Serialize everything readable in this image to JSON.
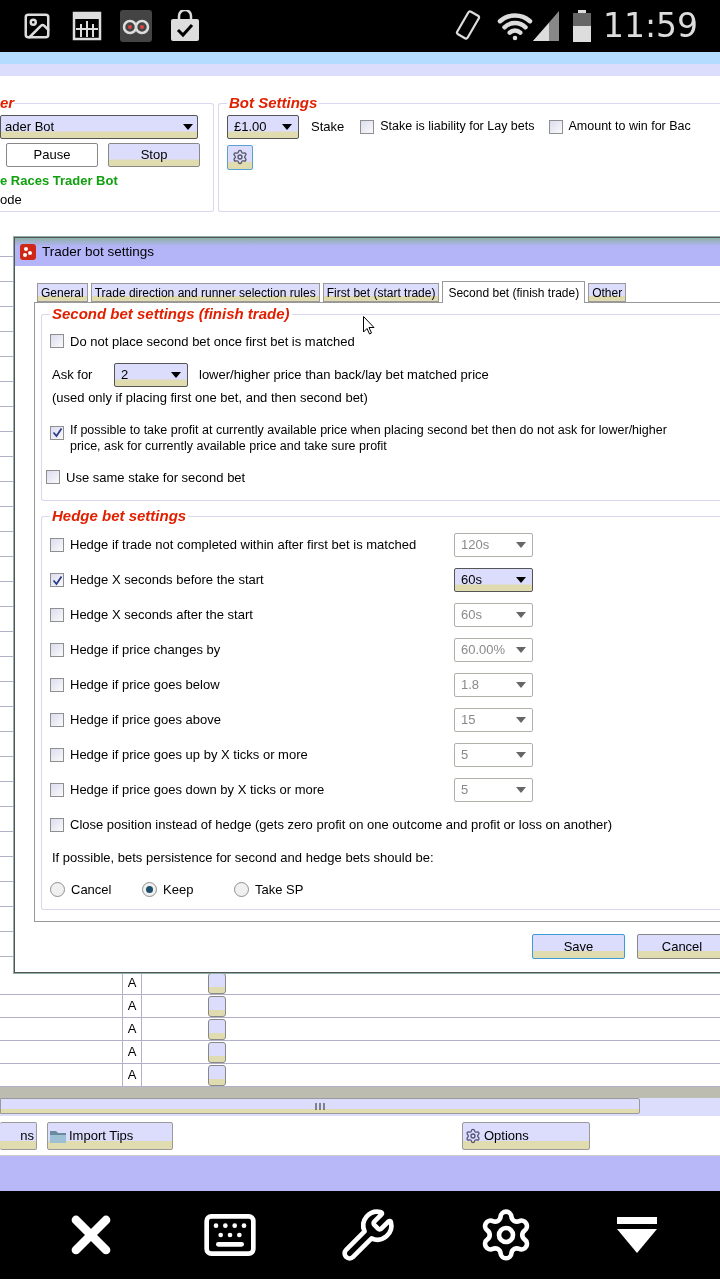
{
  "status_bar": {
    "time": "11:59"
  },
  "trader_panel": {
    "title": "er",
    "bot_select": "ader Bot",
    "buttons": [
      "Pause",
      "Stop"
    ],
    "bot_name": "e Races Trader Bot",
    "mode": "ode"
  },
  "bot_settings": {
    "title": "Bot Settings",
    "stake_select": "£1.00",
    "stake_label": "Stake",
    "checkboxes": [
      {
        "label": "Stake is liability for Lay bets",
        "checked": false
      },
      {
        "label": "Amount to win for Bac",
        "checked": false
      }
    ]
  },
  "dialog": {
    "title": "Trader bot settings",
    "tabs": [
      {
        "label": "General",
        "selected": false
      },
      {
        "label": "Trade direction and runner selection rules",
        "selected": false
      },
      {
        "label": "First bet (start trade)",
        "selected": false
      },
      {
        "label": "Second bet (finish trade)",
        "selected": true
      },
      {
        "label": "Other",
        "selected": false
      }
    ],
    "second_bet": {
      "title": "Second bet settings (finish trade)",
      "do_not_place": {
        "label": "Do not place second bet once first bet is matched",
        "checked": false
      },
      "ask_for": {
        "label": "Ask for",
        "value": "2",
        "suffix": "lower/higher price than back/lay bet matched price",
        "note": "(used only if placing first one bet, and then second bet)"
      },
      "take_profit": {
        "label": "If possible to take profit at currently available price when placing second bet then do not ask for lower/higher price, ask for currently available price and take sure profit",
        "checked": true
      },
      "same_stake": {
        "label": "Use same stake for second bet",
        "checked": false
      }
    },
    "hedge": {
      "title": "Hedge bet settings",
      "rows": [
        {
          "label": "Hedge if trade not completed within after first bet is matched",
          "checked": false,
          "value": "120s"
        },
        {
          "label": "Hedge X seconds before the start",
          "checked": true,
          "value": "60s"
        },
        {
          "label": "Hedge X seconds after the start",
          "checked": false,
          "value": "60s"
        },
        {
          "label": "Hedge if price changes by",
          "checked": false,
          "value": "60.00%"
        },
        {
          "label": "Hedge if price goes below",
          "checked": false,
          "value": "1.8"
        },
        {
          "label": "Hedge if price goes above",
          "checked": false,
          "value": "15"
        },
        {
          "label": "Hedge if price goes up by X ticks or more",
          "checked": false,
          "value": "5"
        },
        {
          "label": "Hedge if price goes down by X ticks or more",
          "checked": false,
          "value": "5"
        }
      ],
      "close_position": {
        "label": "Close position instead of hedge (gets zero profit on one outcome and profit or loss on another)",
        "checked": false
      },
      "persistence_label": "If possible, bets persistence for second and hedge bets should be:",
      "persistence": [
        {
          "label": "Cancel",
          "selected": false
        },
        {
          "label": "Keep",
          "selected": true
        },
        {
          "label": "Take SP",
          "selected": false
        }
      ]
    },
    "buttons": [
      "Save",
      "Cancel"
    ]
  },
  "table": {
    "rows": [
      {
        "column_2": "A"
      },
      {
        "column_2": "A"
      },
      {
        "column_2": "A"
      },
      {
        "column_2": "A"
      },
      {
        "column_2": "A"
      }
    ]
  },
  "bottom_buttons": [
    {
      "label": "ns",
      "kind": "plain"
    },
    {
      "label": "Import Tips",
      "kind": "folder"
    },
    {
      "label": "Options",
      "kind": "gear"
    }
  ]
}
